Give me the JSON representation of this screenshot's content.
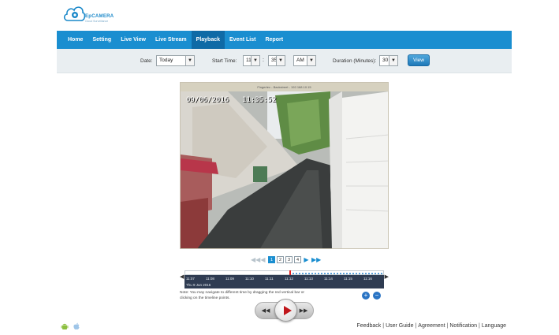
{
  "logo": {
    "name": "EpCAMERA",
    "tagline": "Cloud Surveillance"
  },
  "nav": {
    "items": [
      {
        "label": "Home",
        "active": false
      },
      {
        "label": "Setting",
        "active": false
      },
      {
        "label": "Live View",
        "active": false
      },
      {
        "label": "Live Stream",
        "active": false
      },
      {
        "label": "Playback",
        "active": true
      },
      {
        "label": "Event List",
        "active": false
      },
      {
        "label": "Report",
        "active": false
      }
    ]
  },
  "filters": {
    "date_label": "Date:",
    "date_value": "Today",
    "start_time_label": "Start Time:",
    "hour_value": "11",
    "minute_value": "35",
    "ampm_value": "AM",
    "duration_label": "Duration (Minutes):",
    "duration_value": "30",
    "view_label": "View"
  },
  "video": {
    "title": "Fingertec - Backstreet - 192.168.10.15",
    "osd_date": "09/06/2016",
    "osd_time": "11:35:52"
  },
  "pagination": {
    "pages": [
      "1",
      "2",
      "3",
      "4"
    ],
    "current": "1"
  },
  "timeline": {
    "ticks": [
      "11:07",
      "11:08",
      "11:09",
      "11:10",
      "11:11",
      "11:12",
      "11:13",
      "11:14",
      "11:15",
      "11:16"
    ],
    "date": "Thu 9 Jun 2016",
    "note": "Note: You may navigate to different time by dragging the red vertical bar or clicking on the timeline points."
  },
  "player": {
    "rewind": "◀◀",
    "forward": "▶▶"
  },
  "footer": {
    "links": [
      "Feedback",
      "User Guide",
      "Agreement",
      "Notification",
      "Language"
    ]
  },
  "colors": {
    "nav_bg": "#1a8ed0",
    "nav_active": "#0f6aa6",
    "timeline_bg": "#2f3c52",
    "marker": "#e02020"
  }
}
